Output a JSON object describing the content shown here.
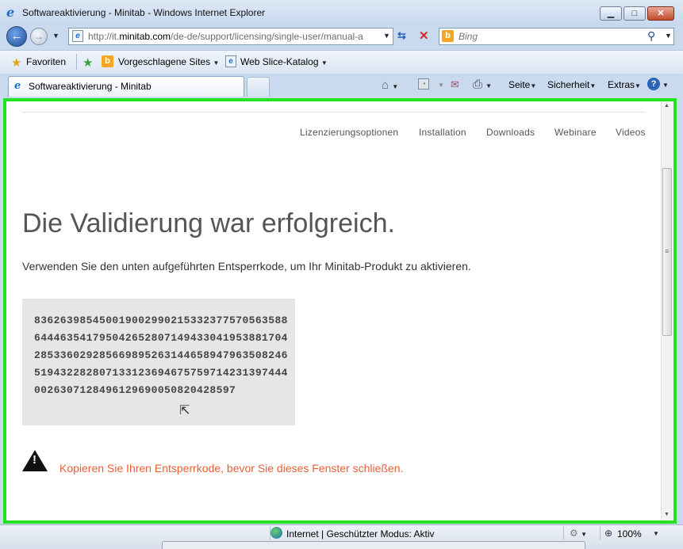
{
  "window": {
    "title": "Softwareaktivierung - Minitab - Windows Internet Explorer",
    "minimize": "▁",
    "maximize": "□",
    "close": "✕"
  },
  "address_bar": {
    "prefix": "http://it.",
    "host": "minitab.com",
    "path": "/de-de/support/licensing/single-user/manual-a"
  },
  "search": {
    "provider": "Bing",
    "placeholder": "Bing"
  },
  "favorites_bar": {
    "favorites_label": "Favoriten",
    "suggested_sites_label": "Vorgeschlagene Sites",
    "web_slice_label": "Web Slice-Katalog"
  },
  "tabs": [
    {
      "label": "Softwareaktivierung - Minitab",
      "active": true
    }
  ],
  "command_bar": {
    "page_label": "Seite",
    "safety_label": "Sicherheit",
    "tools_label": "Extras"
  },
  "page": {
    "nav": [
      "Lizenzierungsoptionen",
      "Installation",
      "Downloads",
      "Webinare",
      "Videos"
    ],
    "heading": "Die Validierung war erfolgreich.",
    "intro": "Verwenden Sie den unten aufgeführten Entsperrkode, um Ihr Minitab-Produkt zu aktivieren.",
    "unlock_code": "8362639854500190029902153323775705635886444635417950426528071494330419538817042853360292856698952631446589479635082465194322828071331236946757597142313974440026307128496129690050820428597",
    "warning": "Kopieren Sie Ihren Entsperrkode, bevor Sie dieses Fenster schließen."
  },
  "status_bar": {
    "zone": "Internet | Geschützter Modus: Aktiv",
    "zoom": "100%"
  },
  "colors": {
    "highlight_border": "#22e322",
    "warning_text": "#e8603a",
    "code_background": "#e6e6e6"
  },
  "icons": [
    "ie-logo-icon",
    "back-arrow-icon",
    "forward-arrow-icon",
    "page-icon",
    "compatibility-icon",
    "stop-icon",
    "bing-icon",
    "search-icon",
    "favorites-star-icon",
    "add-favorites-icon",
    "web-slice-icon",
    "home-icon",
    "feeds-icon",
    "mail-icon",
    "print-icon",
    "help-icon",
    "warning-icon",
    "cursor-icon",
    "globe-icon",
    "zoom-icon"
  ]
}
